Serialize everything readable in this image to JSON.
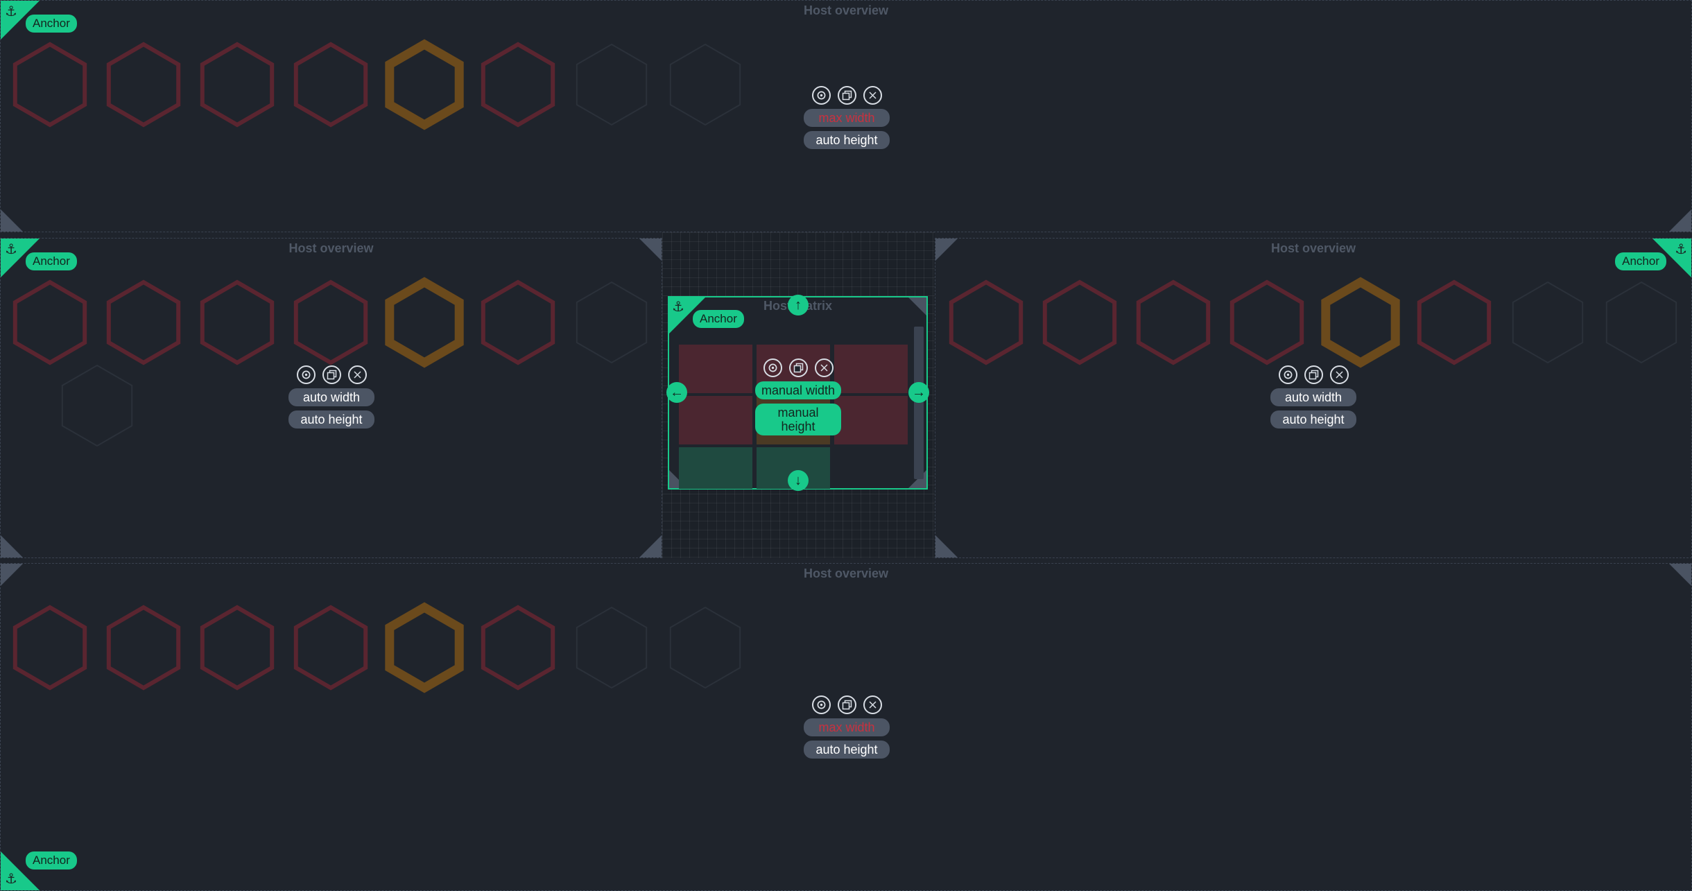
{
  "dashlets": {
    "top": {
      "title": "Host overview",
      "anchor_label": "Anchor",
      "width_label": "max width",
      "height_label": "auto height"
    },
    "left": {
      "title": "Host overview",
      "anchor_label": "Anchor",
      "width_label": "auto width",
      "height_label": "auto height"
    },
    "right": {
      "title": "Host overview",
      "anchor_label": "Anchor",
      "width_label": "auto width",
      "height_label": "auto height"
    },
    "bottom": {
      "title": "Host overview",
      "anchor_label": "Anchor",
      "width_label": "max width",
      "height_label": "auto height"
    },
    "matrix": {
      "title": "Host matrix",
      "anchor_label": "Anchor",
      "width_label": "manual width",
      "height_label": "manual height"
    }
  },
  "icons": {
    "anchor": "anchor-icon",
    "settings": "gear-icon",
    "clone": "clone-icon",
    "close": "close-icon"
  },
  "hexagons": {
    "row_main": [
      "red",
      "red",
      "red",
      "red",
      "orange",
      "red",
      "grey",
      "grey"
    ],
    "row_second": [
      "grey"
    ]
  },
  "colors": {
    "accent": "#18c98a",
    "background": "#1f242c",
    "hex_red": "#5a2530",
    "hex_orange": "#6b4a1c",
    "hex_grey": "#2b313a",
    "warning_text": "#c9313f"
  },
  "arrows": {
    "up": "↑",
    "down": "↓",
    "left": "←",
    "right": "→"
  },
  "anchor_glyph": "⚓"
}
